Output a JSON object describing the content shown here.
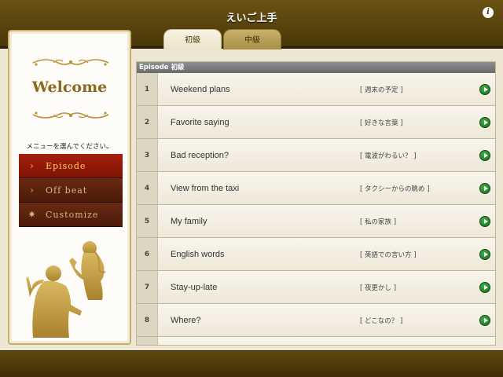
{
  "header": {
    "title": "えいご上手",
    "info_icon": "info-icon",
    "tabs": [
      {
        "label": "初級",
        "selected": true
      },
      {
        "label": "中級",
        "selected": false
      }
    ]
  },
  "sidebar": {
    "welcome": "Welcome",
    "instruction": "メニューを選んでください。",
    "menu": [
      {
        "label": "Episode",
        "icon": "chevron-right-icon",
        "glyph": "›",
        "active": true
      },
      {
        "label": "Off beat",
        "icon": "chevron-right-icon",
        "glyph": "›",
        "active": false
      },
      {
        "label": "Customize",
        "icon": "gear-icon",
        "glyph": "✷",
        "active": false
      }
    ]
  },
  "episodes": {
    "header": "Episode 初級",
    "items": [
      {
        "num": "1",
        "title": "Weekend plans",
        "jp": "[ 週末の予定 ]"
      },
      {
        "num": "2",
        "title": "Favorite saying",
        "jp": "[ 好きな言葉 ]"
      },
      {
        "num": "3",
        "title": "Bad reception?",
        "jp": "[ 電波がわるい？ ]"
      },
      {
        "num": "4",
        "title": "View from the taxi",
        "jp": "[ タクシーからの眺め ]"
      },
      {
        "num": "5",
        "title": "My family",
        "jp": "[ 私の家族 ]"
      },
      {
        "num": "6",
        "title": "English words",
        "jp": "[ 英語での言い方 ]"
      },
      {
        "num": "7",
        "title": "Stay-up-late",
        "jp": "[ 夜更かし ]"
      },
      {
        "num": "8",
        "title": "Where?",
        "jp": "[ どこなの？ ]"
      }
    ]
  },
  "colors": {
    "accent_gold": "#8a6a1c",
    "active_menu": "#a6200e",
    "play_green": "#2a9a30"
  }
}
